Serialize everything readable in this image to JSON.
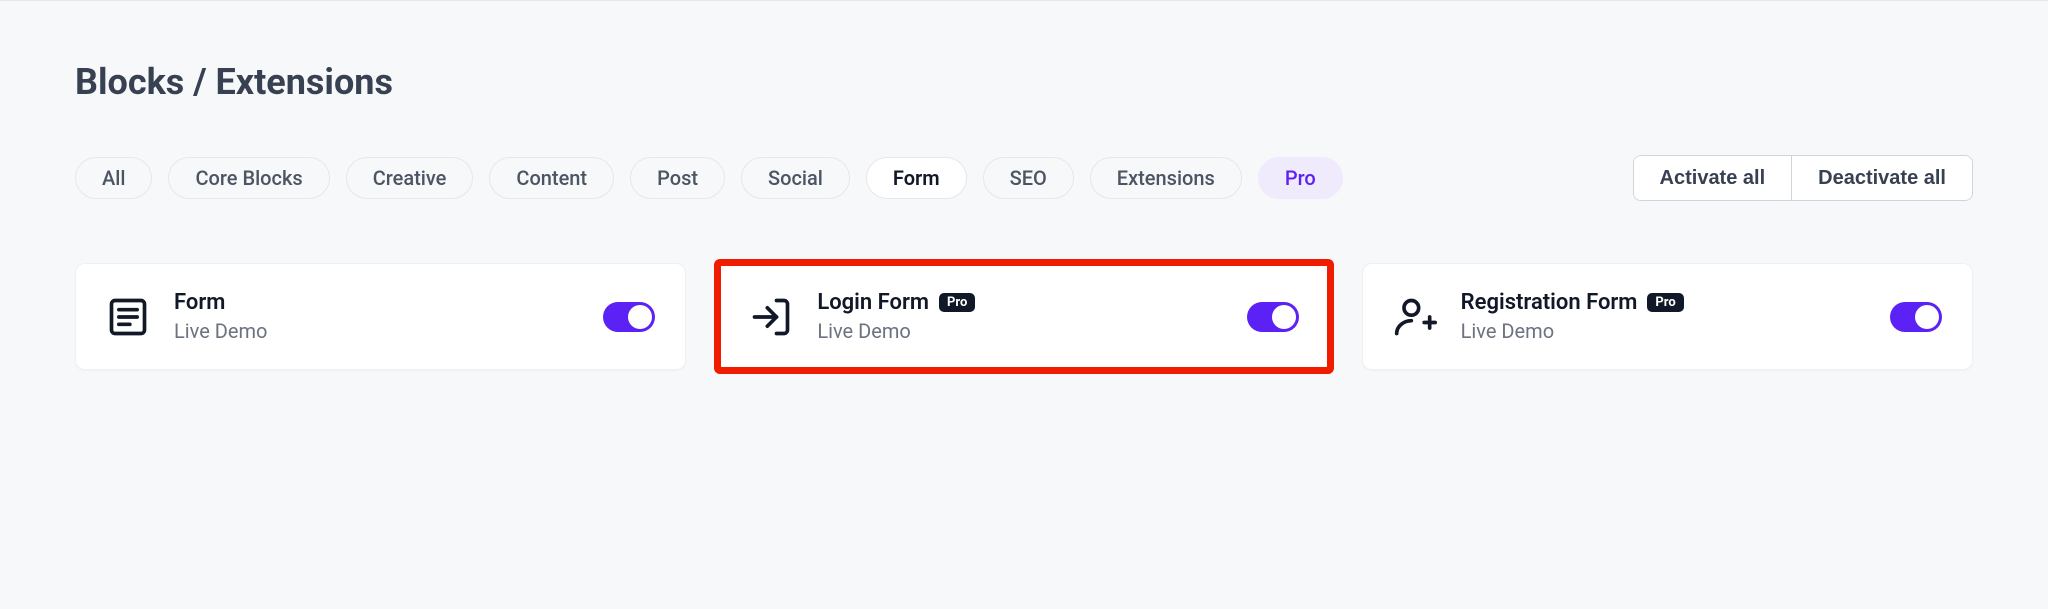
{
  "page": {
    "title": "Blocks / Extensions"
  },
  "filters": {
    "items": [
      {
        "label": "All"
      },
      {
        "label": "Core Blocks"
      },
      {
        "label": "Creative"
      },
      {
        "label": "Content"
      },
      {
        "label": "Post"
      },
      {
        "label": "Social"
      },
      {
        "label": "Form"
      },
      {
        "label": "SEO"
      },
      {
        "label": "Extensions"
      },
      {
        "label": "Pro"
      }
    ]
  },
  "actions": {
    "activate_all": "Activate all",
    "deactivate_all": "Deactivate all"
  },
  "cards": {
    "form": {
      "title": "Form",
      "link": "Live Demo"
    },
    "login": {
      "title": "Login Form",
      "badge": "Pro",
      "link": "Live Demo"
    },
    "registration": {
      "title": "Registration Form",
      "badge": "Pro",
      "link": "Live Demo"
    }
  }
}
